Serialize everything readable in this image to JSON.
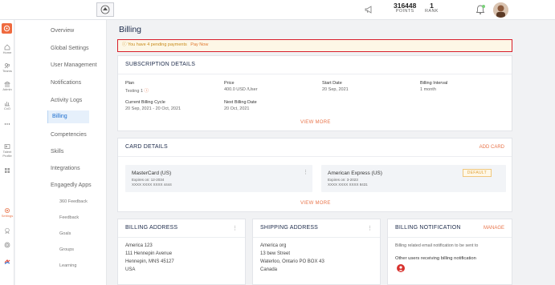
{
  "topbar": {
    "logo_text": "",
    "points_value": "316448",
    "points_label": "POINTS",
    "rank_value": "1",
    "rank_label": "RANK"
  },
  "rail": {
    "items": [
      {
        "label": "Home",
        "icon": "home-icon"
      },
      {
        "label": "Teams",
        "icon": "teams-icon"
      },
      {
        "label": "Admin",
        "icon": "admin-icon"
      },
      {
        "label": "CxO",
        "icon": "chart-icon"
      },
      {
        "label": "",
        "icon": "more-icon"
      },
      {
        "label": "Talent Profile",
        "icon": "talent-icon"
      },
      {
        "label": "",
        "icon": "grid-icon"
      },
      {
        "label": "Settings",
        "icon": "settings-icon"
      },
      {
        "label": "",
        "icon": "badge-icon"
      },
      {
        "label": "",
        "icon": "target-icon"
      },
      {
        "label": "",
        "icon": "brand-icon"
      }
    ]
  },
  "subnav": {
    "items": [
      "Overview",
      "Global Settings",
      "User Management",
      "Notifications",
      "Activity Logs",
      "Billing",
      "Competencies",
      "Skills",
      "Integrations",
      "Engagedly Apps"
    ],
    "sub_items": [
      "360 Feedback",
      "Feedback",
      "Goals",
      "Groups",
      "Learning"
    ]
  },
  "page": {
    "title": "Billing",
    "alert_text": "You have 4 pending payments",
    "alert_link": "Pay Now"
  },
  "subscription": {
    "title": "SUBSCRIPTION DETAILS",
    "plan_label": "Plan",
    "plan_value": "Testing 1",
    "price_label": "Price",
    "price_value": "400.0 USD /User",
    "start_label": "Start Date",
    "start_value": "20 Sep, 2021",
    "interval_label": "Billing Interval",
    "interval_value": "1 month",
    "cycle_label": "Current Billing Cycle",
    "cycle_value": "20 Sep, 2021 - 20 Oct, 2021",
    "next_label": "Next Billing Date",
    "next_value": "20 Oct, 2021",
    "view_more": "VIEW MORE"
  },
  "cards": {
    "title": "CARD DETAILS",
    "add_card": "ADD CARD",
    "list": [
      {
        "name": "MasterCard (US)",
        "expires": "Expires on: 12-2034",
        "number": "XXXX XXXX XXXX 4444"
      },
      {
        "name": "American Express (US)",
        "expires": "Expires on: 3-2023",
        "number": "XXXX XXXX XXXX 8431",
        "badge": "DEFAULT"
      }
    ],
    "view_more": "VIEW MORE"
  },
  "billing_address": {
    "title": "BILLING ADDRESS",
    "lines": [
      "America 123",
      "111 Hennepin Avenue",
      "Hennepin, MNS 45127",
      "USA"
    ]
  },
  "shipping_address": {
    "title": "SHIPPING ADDRESS",
    "lines": [
      "America org",
      "13 bew Street",
      "Waterloo, Ontario PO BOX 43",
      "Canada"
    ]
  },
  "billing_notification": {
    "title": "BILLING NOTIFICATION",
    "manage": "MANAGE",
    "desc": "Billing related email notification to be sent to",
    "others": "Other users receiving billing notification"
  },
  "colors": {
    "accent": "#e8744a",
    "alert_border": "#d81f2c",
    "active_nav": "#1e6fcf"
  }
}
